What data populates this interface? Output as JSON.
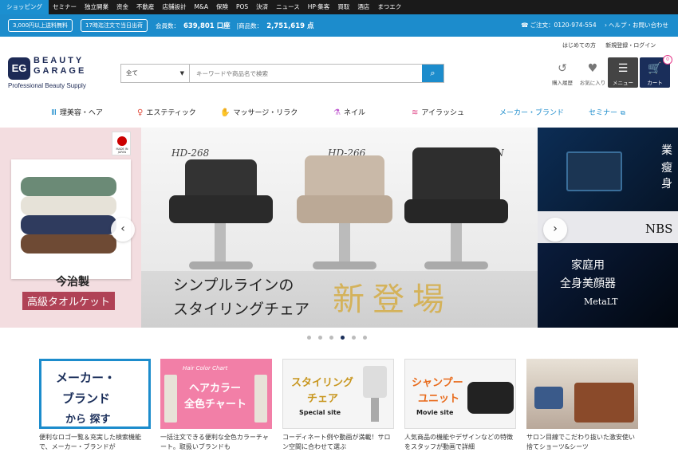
{
  "topnav": {
    "tabs": [
      "ショッピング",
      "セミナー",
      "独立開業",
      "资金",
      "不動産",
      "店舗設計",
      "M&A",
      "保険",
      "POS",
      "決済",
      "ニュース",
      "HP·集客",
      "買取",
      "酒店",
      "まつエク"
    ]
  },
  "infobar": {
    "pill1": "3,000円以上送料無料",
    "pill2": "17時迄注文で当日出荷",
    "member_label": "会員数：",
    "member_value": "639,801 口座",
    "product_label": "|商品数：",
    "product_value": "2,751,619 点",
    "phone": "ご注文：0120-974-554",
    "help": "ヘルプ・お問い合わせ"
  },
  "header": {
    "logo_mark": "EG",
    "logo_line1": "BEAUTY",
    "logo_line2": "GARAGE",
    "logo_sub": "Professional Beauty Supply",
    "search_category": "全て",
    "search_placeholder": "キーワードや商品名で検索",
    "link_beginner": "はじめての方",
    "link_login": "新規登録・ログイン",
    "history_label": "購入履歴",
    "favorite_label": "お気に入り",
    "menu_label": "メニュー",
    "cart_label": "カート",
    "cart_count": "0"
  },
  "categories": [
    {
      "label": "理美容・ヘア",
      "icon": "scissors-comb-icon",
      "color": "#1c8ccc"
    },
    {
      "label": "エステティック",
      "icon": "person-icon",
      "color": "#e04a3a"
    },
    {
      "label": "マッサージ・リラク",
      "icon": "hand-icon",
      "color": "#2eaa4a"
    },
    {
      "label": "ネイル",
      "icon": "nail-polish-icon",
      "color": "#c05ad0"
    },
    {
      "label": "アイラッシュ",
      "icon": "eyelash-icon",
      "color": "#e04a8a"
    },
    {
      "label": "メーカー・ブランド",
      "icon": "",
      "color": "#1c8ccc"
    },
    {
      "label": "セミナー",
      "icon": "external-link-icon",
      "color": "#1c8ccc"
    }
  ],
  "banner": {
    "left": {
      "made_in": "MADE IN JAPAN",
      "imabari": "今治製",
      "towel": "高級タオルケット"
    },
    "main": {
      "models": [
        "HD-268",
        "HD-266",
        "DAN"
      ],
      "copy1": "シンプルラインの",
      "copy2": "スタイリングチェア",
      "big": "新登場"
    },
    "right": {
      "t1": "業",
      "t2": "瘦身",
      "nbs": "NBS",
      "b1": "家庭用",
      "b2": "全身美顔器",
      "b3": "MetaLT"
    },
    "dots_total": 6,
    "dots_active": 4
  },
  "cards": [
    {
      "title1": "メーカー・",
      "title2": "ブランド",
      "title3": "から 探す",
      "desc": "便利なロゴ一覧＆充実した検索機能で、メーカー・ブランドが"
    },
    {
      "small": "Hair Color Chart",
      "title1": "ヘアカラー",
      "title2": "全色チャート",
      "desc": "一括注文できる便利な全色カラーチャート。取扱いブランドも"
    },
    {
      "title1": "スタイリング",
      "title2": "チェア",
      "sub": "Special site",
      "desc": "コーディネート例や動画が満載！サロン空間に合わせて選ぶ"
    },
    {
      "title1": "シャンプー",
      "title2": "ユニット",
      "sub": "Movie site",
      "desc": "人気商品の機能やデザインなどの特徴をスタッフが動画で詳細"
    },
    {
      "desc": "サロン目線でこだわり抜いた激安使い捨てショーツ&シーツ"
    }
  ]
}
